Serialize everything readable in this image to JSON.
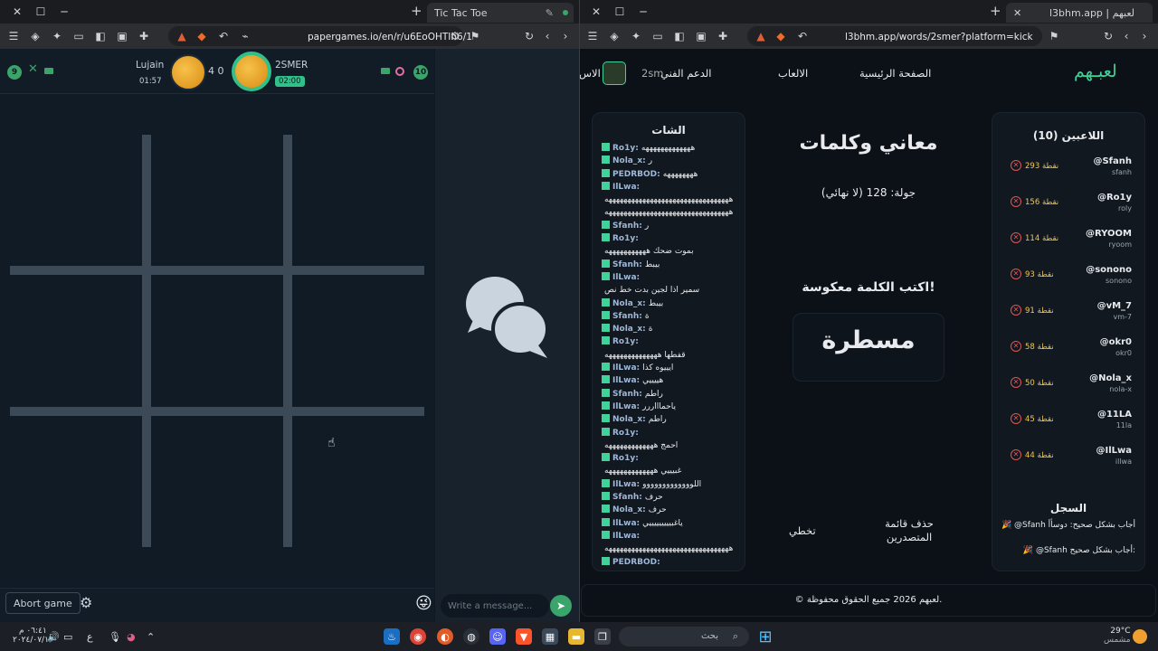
{
  "left_window": {
    "tab_title": "Tic Tac Toe",
    "url": "papergames.io/en/r/u6EoOHTIh6/1",
    "game": {
      "player1": {
        "name": "Lujain",
        "time": "01:57",
        "score": "9"
      },
      "player2": {
        "name": "2SMER",
        "time": "02:00",
        "score": "10"
      },
      "vs_score": "4 0",
      "abort_label": "Abort game",
      "message_placeholder": "Write a message..."
    }
  },
  "right_window": {
    "tab_title": "l3bhm.app | لعبهم",
    "url": "l3bhm.app/words/2smer?platform=kick",
    "logo": "لعبـهم",
    "nav": {
      "home": "الصفحة الرئيسية",
      "games": "الالعاب",
      "support": "الدعم الفني",
      "user": "2sm",
      "cut": "الاس"
    },
    "chat": {
      "title": "الشات",
      "lines": [
        {
          "user": "Ro1y:",
          "text": "هههههههههههههه"
        },
        {
          "user": "Nola_x:",
          "text": "ر"
        },
        {
          "user": "PEDRBOD:",
          "text": "ههههههههه"
        },
        {
          "user": "IlLwa:",
          "text": ""
        },
        {
          "user": "",
          "text": "هههههههههههههههههههههههههههههههههه"
        },
        {
          "user": "",
          "text": "هههههههههههههههههههههههههههههههههه"
        },
        {
          "user": "Sfanh:",
          "text": "ر"
        },
        {
          "user": "Ro1y:",
          "text": ""
        },
        {
          "user": "",
          "text": "بموت ضحك هههههههههههه"
        },
        {
          "user": "Sfanh:",
          "text": "بيبط"
        },
        {
          "user": "IlLwa:",
          "text": ""
        },
        {
          "user": "",
          "text": "سمير اذا لجين بدت خط نص"
        },
        {
          "user": "Nola_x:",
          "text": "بيبط"
        },
        {
          "user": "Sfanh:",
          "text": "ة"
        },
        {
          "user": "Nola_x:",
          "text": "ة"
        },
        {
          "user": "Ro1y:",
          "text": ""
        },
        {
          "user": "",
          "text": "قفطها ههههههههههههههه"
        },
        {
          "user": "IlLwa:",
          "text": "ايييوه كذا"
        },
        {
          "user": "IlLwa:",
          "text": "هييييي"
        },
        {
          "user": "Sfanh:",
          "text": "راطم"
        },
        {
          "user": "IlLwa:",
          "text": "ياحماااررر"
        },
        {
          "user": "Nola_x:",
          "text": "راطم"
        },
        {
          "user": "Ro1y:",
          "text": ""
        },
        {
          "user": "",
          "text": "احمج هههههههههههههه"
        },
        {
          "user": "Ro1y:",
          "text": ""
        },
        {
          "user": "",
          "text": "غبيييي هههههههههههههه"
        },
        {
          "user": "IlLwa:",
          "text": "اللووووووووووووو"
        },
        {
          "user": "Sfanh:",
          "text": "حرف"
        },
        {
          "user": "Nola_x:",
          "text": "حرف"
        },
        {
          "user": "IlLwa:",
          "text": "ياغبيييييييييي"
        },
        {
          "user": "IlLwa:",
          "text": ""
        },
        {
          "user": "",
          "text": "هههههههههههههههههههههههههههههههههه"
        },
        {
          "user": "PEDRBOD:",
          "text": ""
        }
      ]
    },
    "game": {
      "title": "معاني وكلمات",
      "round": "جولة: 128 (لا نهائي)",
      "instruction": "اكتب الكلمة معكوسة!",
      "word": "مسطرة",
      "skip_label": "تخطي",
      "clear_leaderboard_label": "حذف قائمة المتصدرين"
    },
    "players": {
      "title": "اللاعبين (10)",
      "list": [
        {
          "name": "@Sfanh",
          "id": "sfanh",
          "points": "293 نقطة"
        },
        {
          "name": "@Ro1y",
          "id": "roly",
          "points": "156 نقطة"
        },
        {
          "name": "@RYOOM",
          "id": "ryoom",
          "points": "114 نقطة"
        },
        {
          "name": "@sonono",
          "id": "sonono",
          "points": "93 نقطة"
        },
        {
          "name": "@vM_7",
          "id": "vm-7",
          "points": "91 نقطة"
        },
        {
          "name": "@okr0",
          "id": "okr0",
          "points": "58 نقطة"
        },
        {
          "name": "@Nola_x",
          "id": "nola-x",
          "points": "50 نقطة"
        },
        {
          "name": "@11LA",
          "id": "11la",
          "points": "45 نقطة"
        },
        {
          "name": "@IlLwa",
          "id": "illwa",
          "points": "44 نقطة"
        }
      ]
    },
    "log": {
      "title": "السجل",
      "lines": [
        "🎉 @Sfanh أجاب بشكل صحيح: دوسأأ",
        "🎉 @Sfanh أجاب بشكل صحيح:"
      ]
    },
    "footer": "© لعبهم 2026 جميع الحقوق محفوظة."
  },
  "taskbar": {
    "search_placeholder": "بحث",
    "lang": "ع",
    "time": "٠٦:٤١ م",
    "date": "٢٠٢٤/٠٧/١٣",
    "weather_temp": "29°C",
    "weather_desc": "مشمس"
  }
}
